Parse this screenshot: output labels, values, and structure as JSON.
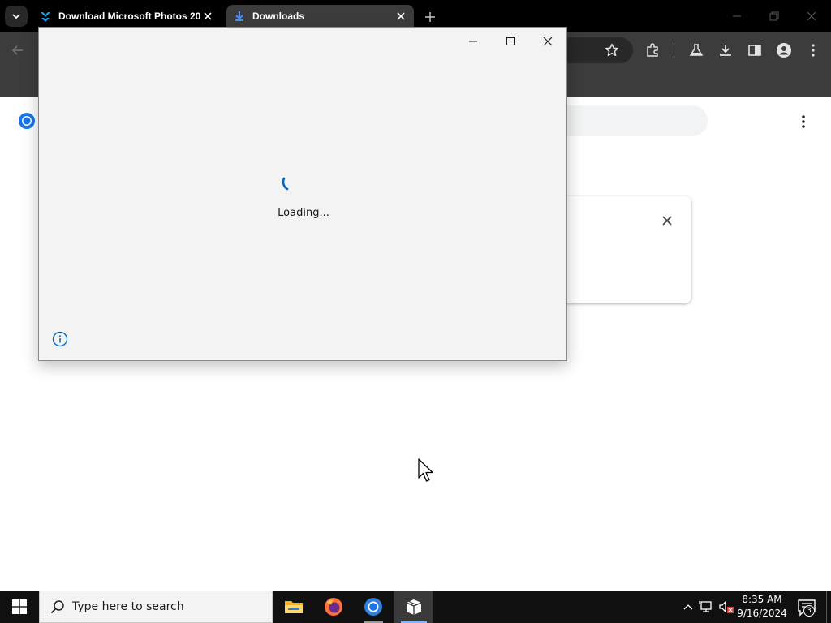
{
  "browser": {
    "tabs": [
      {
        "title": "Download Microsoft Photos 20",
        "favicon": "download-arrow-icon",
        "active": false
      },
      {
        "title": "Downloads",
        "favicon": "download-icon",
        "active": true
      }
    ],
    "toolbar_icons": [
      "back-icon",
      "star-icon",
      "extensions-icon",
      "labs-icon",
      "download-icon",
      "side-panel-icon",
      "profile-icon",
      "menu-icon"
    ]
  },
  "installer": {
    "status": "Loading...",
    "icons": [
      "minimize-icon",
      "maximize-icon",
      "close-icon",
      "spinner-icon",
      "info-icon"
    ]
  },
  "taskbar": {
    "search_placeholder": "Type here to search",
    "apps": [
      "file-explorer-icon",
      "firefox-icon",
      "chrome-icon",
      "installer-icon"
    ],
    "clock": {
      "time": "8:35 AM",
      "date": "9/16/2024"
    },
    "notification_count": "3"
  },
  "colors": {
    "accent": "#0067c0",
    "tab_strip": "#000000",
    "toolbar": "#3c3c3c",
    "taskbar": "#101010",
    "dialog_bg": "#f3f3f3"
  }
}
